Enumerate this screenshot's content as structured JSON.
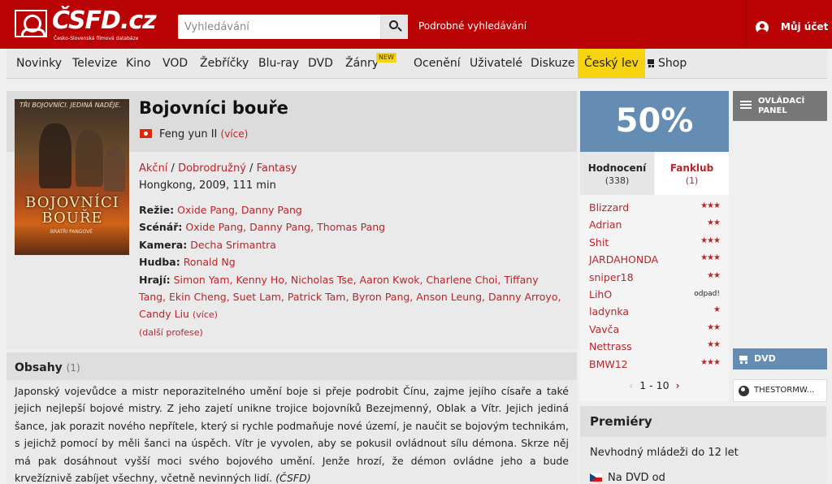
{
  "header": {
    "logo_text": "ČSFD.cz",
    "logo_subtitle": "Česko-Slovenská filmová databáze",
    "search_placeholder": "Vyhledávání",
    "advanced_search": "Podrobné vyhledávání",
    "account_label": "Můj účet"
  },
  "nav": {
    "items": [
      "Novinky",
      "Televize",
      "Kino",
      "VOD",
      "Žebříčky",
      "Blu-ray",
      "DVD",
      "Žánry",
      "Ocenění",
      "Uživatelé",
      "Diskuze",
      "Český lev",
      "Shop"
    ],
    "new_badge": "NEW"
  },
  "film": {
    "title": "Bojovníci bouře",
    "original_title": "Feng yun II",
    "more": "(více)",
    "genres": [
      "Akční",
      "Dobrodružný",
      "Fantasy"
    ],
    "origin": "Hongkong, 2009, 111 min",
    "poster": {
      "tagline": "TŘI BOJOVNÍCI. JEDINÁ NADĚJE.",
      "title": "BOJOVNÍCI BOUŘE",
      "credit": "BRATŘI PANGOVÉ"
    },
    "creators": {
      "directing_label": "Režie:",
      "directing": "Oxide Pang, Danny Pang",
      "screenplay_label": "Scénář:",
      "screenplay": "Oxide Pang, Danny Pang, Thomas Pang",
      "camera_label": "Kamera:",
      "camera": "Decha Srimantra",
      "music_label": "Hudba:",
      "music": "Ronald Ng",
      "cast_label": "Hrají:",
      "cast": "Simon Yam, Kenny Ho, Nicholas Tse, Aaron Kwok, Charlene Choi, Tiffany Tang, Ekin Cheng, Suet Lam, Patrick Tam, Byron Pang, Anson Leung, Danny Arroyo, Candy Liu",
      "cast_more": "(více)",
      "more_professions": "(další profese)"
    }
  },
  "synopsis": {
    "title": "Obsahy",
    "count": "(1)",
    "text": "Japonský vojevůdce a mistr neporazitelného umění boje si přeje podrobit Čínu, zajme jejího císaře a také jejich nejlepší bojové mistry. Z jeho zajetí unikne trojice bojovníků Bezejmenný, Oblak a Vítr. Jejich jediná šance, jak porazit nového nepřítele, který si rychle podmaňuje nové území, je naučit se bojovým technikám, s jejichž pomocí by měli šanci na úspěch. Vítr je vyvolen, aby se pokusil ovládnout sílu démona. Skrze něj má pak dosáhnout vyšší moci svého bojového umění. Jenže hrozí, že démon ovládne jeho a bude krvežíznivě zabíjet všechny, včetně nevinných lidí.",
    "source": "(ČSFD)"
  },
  "rating": {
    "value": "50%",
    "color": "#658db4",
    "tab_ratings": "Hodnocení",
    "tab_ratings_count": "(338)",
    "tab_fanclub": "Fanklub",
    "tab_fanclub_count": "(1)",
    "users": [
      {
        "name": "Blizzard",
        "stars": "★★★"
      },
      {
        "name": "Adrian",
        "stars": "★★"
      },
      {
        "name": "Shit",
        "stars": "★★★"
      },
      {
        "name": "JARDAHONDA",
        "stars": "★★★"
      },
      {
        "name": "sniper18",
        "stars": "★★"
      },
      {
        "name": "LihO",
        "stars": "odpad!"
      },
      {
        "name": "ladynka",
        "stars": "★"
      },
      {
        "name": "Vavča",
        "stars": "★★"
      },
      {
        "name": "Nettrass",
        "stars": "★★"
      },
      {
        "name": "BMW12",
        "stars": "★★★"
      }
    ],
    "pager": "1 - 10",
    "prev_arrow": "‹",
    "next_arrow": "›"
  },
  "sidebar": {
    "control_panel": "OVLÁDACÍ\nPANEL",
    "dvd": "DVD",
    "external": "THESTORMW..."
  },
  "premieres": {
    "title": "Premiéry",
    "age": "Nevhodný mládeži do 12 let",
    "dvd": "Na DVD od"
  }
}
